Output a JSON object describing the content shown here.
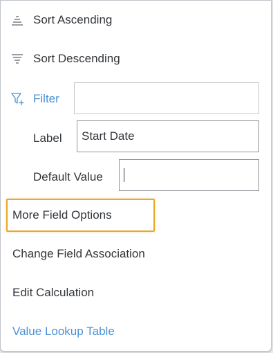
{
  "menu": {
    "sort_ascending": {
      "label": "Sort Ascending",
      "icon": "sort-ascending-icon"
    },
    "sort_descending": {
      "label": "Sort Descending",
      "icon": "sort-descending-icon"
    },
    "filter": {
      "label": "Filter",
      "icon": "filter-add-icon",
      "value": ""
    },
    "label_field": {
      "label": "Label",
      "value": "Start Date"
    },
    "default_value_field": {
      "label": "Default Value",
      "value": ""
    },
    "more_field_options": "More Field Options",
    "change_field_association": "Change Field Association",
    "edit_calculation": "Edit Calculation",
    "value_lookup_table": "Value Lookup Table"
  },
  "colors": {
    "link_blue": "#4a90d6",
    "highlight": "#e9a825",
    "text": "#32363a"
  }
}
